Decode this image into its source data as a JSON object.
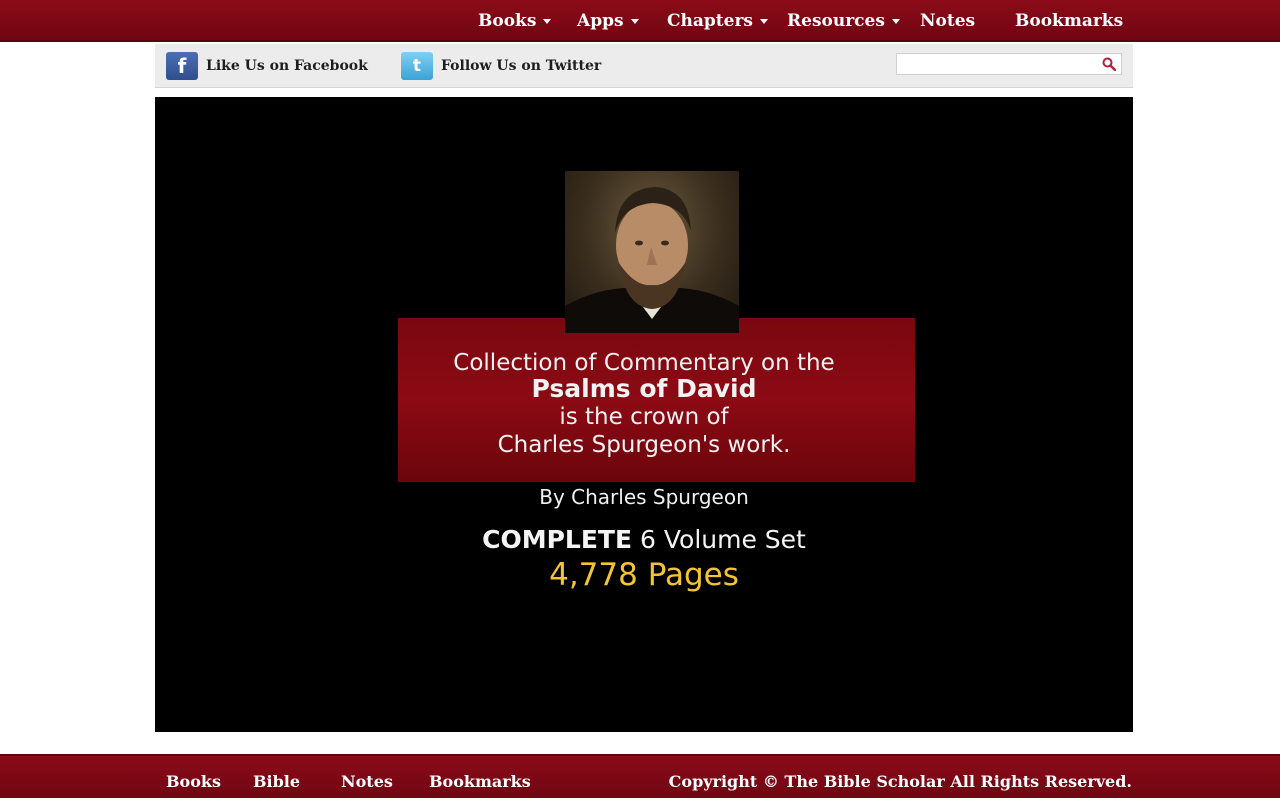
{
  "topnav": {
    "items": [
      {
        "label": "Books",
        "dropdown": true
      },
      {
        "label": "Apps",
        "dropdown": true
      },
      {
        "label": "Chapters",
        "dropdown": true
      },
      {
        "label": "Resources",
        "dropdown": true
      },
      {
        "label": "Notes",
        "dropdown": false
      },
      {
        "label": "Bookmarks",
        "dropdown": false
      }
    ]
  },
  "social": {
    "facebook_label": "Like Us on Facebook",
    "twitter_label": "Follow Us on Twitter",
    "facebook_icon": "f",
    "twitter_icon": "t"
  },
  "search": {
    "value": "",
    "placeholder": ""
  },
  "banner": {
    "line1": "Collection of Commentary on the",
    "line2": "Psalms of David",
    "line3": "is the crown of",
    "line4": "Charles Spurgeon's work.",
    "byline": "By Charles Spurgeon",
    "complete_bold": "COMPLETE",
    "complete_rest": " 6 Volume Set",
    "pages": "4,778 Pages"
  },
  "footer": {
    "items": [
      "Books",
      "Bible",
      "Notes",
      "Bookmarks"
    ],
    "copyright": "Copyright © The Bible Scholar All Rights Reserved."
  },
  "colors": {
    "brand_red": "#7a0812",
    "accent_gold": "#f5c431",
    "search_icon": "#b3213b"
  }
}
